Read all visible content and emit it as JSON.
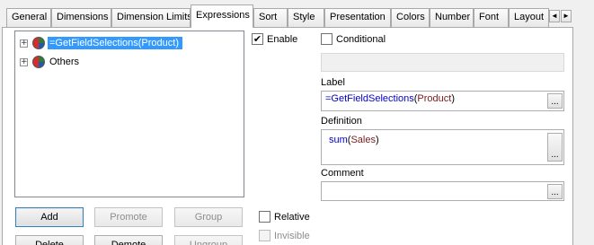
{
  "tabs": [
    {
      "label": "General",
      "active": false
    },
    {
      "label": "Dimensions",
      "active": false
    },
    {
      "label": "Dimension Limits",
      "active": false
    },
    {
      "label": "Expressions",
      "active": true
    },
    {
      "label": "Sort",
      "active": false
    },
    {
      "label": "Style",
      "active": false
    },
    {
      "label": "Presentation",
      "active": false
    },
    {
      "label": "Colors",
      "active": false
    },
    {
      "label": "Number",
      "active": false
    },
    {
      "label": "Font",
      "active": false
    },
    {
      "label": "Layout",
      "active": false
    }
  ],
  "tab_scroll": {
    "left": "◄",
    "right": "►"
  },
  "tree": {
    "items": [
      {
        "expander": "+",
        "icon": "pie-chart-icon",
        "label": "=GetFieldSelections(Product)",
        "selected": true
      },
      {
        "expander": "+",
        "icon": "pie-chart-icon",
        "label": "Others",
        "selected": false
      }
    ]
  },
  "buttons": {
    "add": "Add",
    "promote": "Promote",
    "group": "Group",
    "delete": "Delete",
    "demote": "Demote",
    "ungroup": "Ungroup"
  },
  "checkboxes": {
    "enable": {
      "label": "Enable",
      "checked": true,
      "mark": "✔"
    },
    "conditional": {
      "label": "Conditional",
      "checked": false
    },
    "relative": {
      "label": "Relative",
      "checked": false
    },
    "invisible": {
      "label": "Invisible",
      "checked": false,
      "disabled": true
    }
  },
  "fields": {
    "label": {
      "title": "Label",
      "fn": "=GetFieldSelections",
      "open": "(",
      "arg": "Product",
      "close": ")"
    },
    "definition": {
      "title": "Definition",
      "fn": "sum",
      "open": "(",
      "arg": "Sales",
      "close": ")"
    },
    "comment": {
      "title": "Comment",
      "value": ""
    },
    "ellipsis": "..."
  }
}
